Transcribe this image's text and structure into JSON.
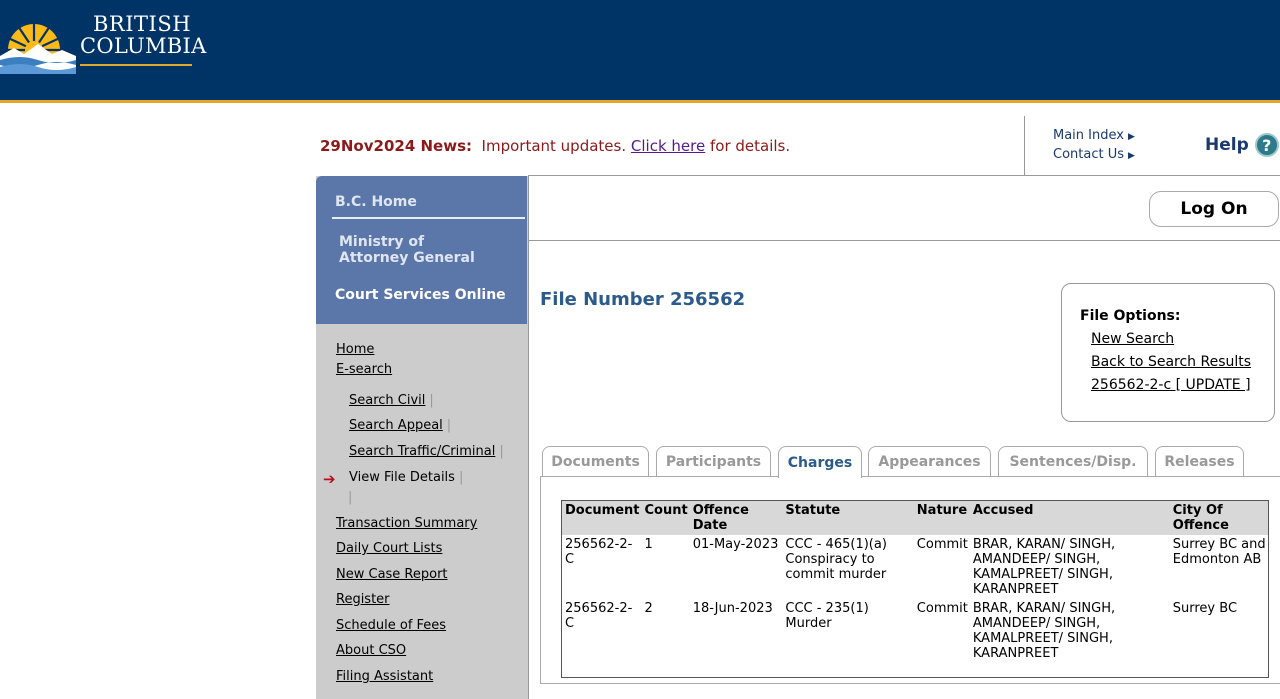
{
  "banner": {
    "logo_line1": "BRITISH",
    "logo_line2": "COLUMBIA",
    "colors": {
      "background": "#003366",
      "accent": "#e3a82b"
    }
  },
  "news": {
    "date_label": "29Nov2024 News:",
    "text": "Important updates.",
    "link": "Click here",
    "suffix": "for details."
  },
  "top_links": {
    "main_index": "Main Index",
    "contact_us": "Contact Us",
    "help": "Help",
    "help_icon": "question-icon"
  },
  "sidebar": {
    "bc_home": "B.C. Home",
    "ministry_line1": "Ministry of",
    "ministry_line2": "Attorney General",
    "cso": "Court Services Online",
    "nav": {
      "home": "Home",
      "esearch": "E-search",
      "search_civil": "Search Civil",
      "search_appeal": "Search Appeal",
      "search_traffic": "Search Traffic/Criminal",
      "view_file": "View File Details",
      "transaction": "Transaction Summary",
      "daily": "Daily Court Lists",
      "new_case": "New Case Report",
      "register": "Register",
      "fees": "Schedule of Fees",
      "about": "About CSO",
      "filing": "Filing Assistant"
    },
    "bar_char": "|",
    "arrow_char": "➔"
  },
  "header": {
    "logon": "Log On"
  },
  "file": {
    "title": "File Number 256562"
  },
  "file_options": {
    "title": "File Options:",
    "new_search": "New Search",
    "back": "Back to Search Results",
    "update": "256562-2-c [ UPDATE ]"
  },
  "tabs": {
    "documents": "Documents",
    "participants": "Participants",
    "charges": "Charges",
    "appearances": "Appearances",
    "sentences": "Sentences/Disp.",
    "releases": "Releases"
  },
  "charges_table": {
    "headers": {
      "document": "Document",
      "count": "Count",
      "offence_date": "Offence Date",
      "statute": "Statute",
      "nature": "Nature",
      "accused": "Accused",
      "city": "City Of Offence"
    },
    "rows": [
      {
        "document": "256562-2-C",
        "count": "1",
        "offence_date": "01-May-2023",
        "statute": "CCC - 465(1)(a) Conspiracy to commit murder",
        "nature": "Commit",
        "accused": "BRAR, KARAN/ SINGH, AMANDEEP/ SINGH, KAMALPREET/ SINGH, KARANPREET",
        "city": "Surrey BC and Edmonton AB"
      },
      {
        "document": "256562-2-C",
        "count": "2",
        "offence_date": "18-Jun-2023",
        "statute": "CCC - 235(1) Murder",
        "nature": "Commit",
        "accused": "BRAR, KARAN/ SINGH, AMANDEEP/ SINGH, KAMALPREET/ SINGH, KARANPREET",
        "city": "Surrey BC"
      }
    ]
  }
}
